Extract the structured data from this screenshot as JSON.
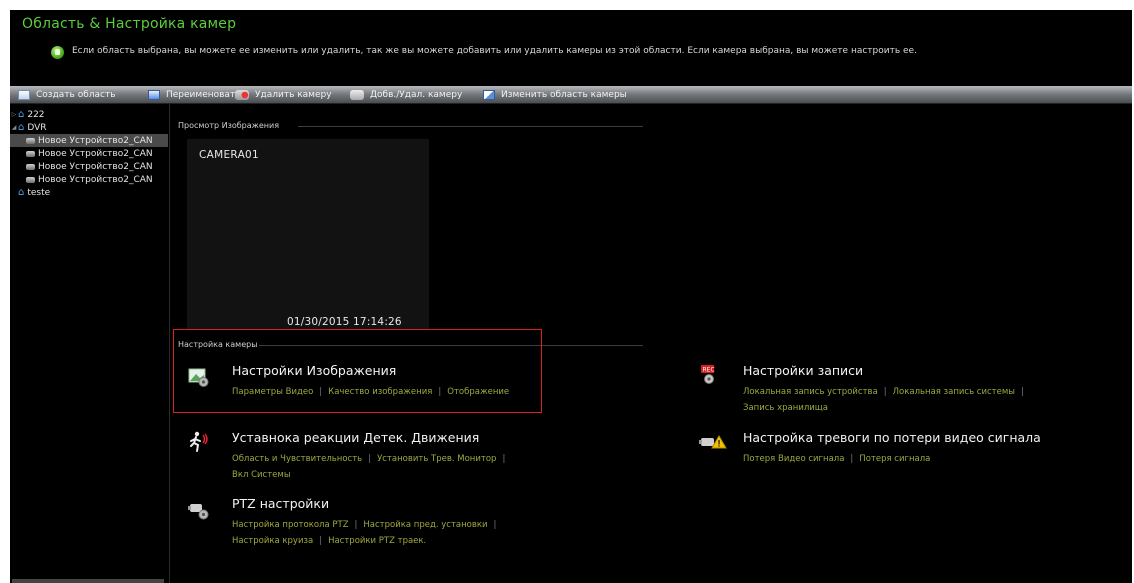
{
  "header": {
    "title": "Область & Настройка камер",
    "hint": "Если область выбрана, вы можете ее изменить или удалить, так же вы можете добавить или удалить камеры из этой области. Если камера выбрана, вы можете настроить ее."
  },
  "toolbar": {
    "create_area": "Создать область",
    "rename": "Переименовать",
    "delete_camera": "Удалить камеру",
    "add_remove_camera": "Добв./Удал. камеру",
    "change_camera_area": "Изменить область камеры"
  },
  "tree": {
    "items": [
      {
        "label": "222",
        "level": 0
      },
      {
        "label": "DVR",
        "level": 0
      },
      {
        "label": "Новое Устройство2_CAN",
        "level": 1
      },
      {
        "label": "Новое Устройство2_CAN",
        "level": 1
      },
      {
        "label": "Новое Устройство2_CAN",
        "level": 1
      },
      {
        "label": "Новое Устройство2_CAN",
        "level": 1
      },
      {
        "label": "teste",
        "level": 0
      }
    ]
  },
  "preview": {
    "section_label": "Просмотр Изображения",
    "camera_name": "CAMERA01",
    "timestamp": "01/30/2015 17:14:26"
  },
  "settings": {
    "section_label": "Настройка камеры",
    "image": {
      "title": "Настройки Изображения",
      "links": [
        "Параметры Видео",
        "Качество изображения",
        "Отображение"
      ]
    },
    "motion": {
      "title": "Уставнока реакции Детек. Движения",
      "links": [
        "Область и Чувствительность",
        "Установить Трев. Монитор",
        "Вкл Системы"
      ]
    },
    "ptz": {
      "title": "PTZ настройки",
      "links": [
        "Настройка протокола PTZ",
        "Настройка пред. установки",
        "Настройка круиза",
        "Настройки PTZ траек."
      ]
    },
    "record": {
      "title": "Настройки записи",
      "links": [
        "Локальная запись устройства",
        "Локальная запись системы",
        "Запись хранилища"
      ]
    },
    "video_loss": {
      "title": "Настройка тревоги по потери видео сигнала",
      "links": [
        "Потеря Видео сигнала",
        "Потеря сигнала"
      ]
    }
  },
  "colors": {
    "accent": "#5ccc3c",
    "link": "#9fa83e",
    "highlight_border": "#d8201c"
  }
}
